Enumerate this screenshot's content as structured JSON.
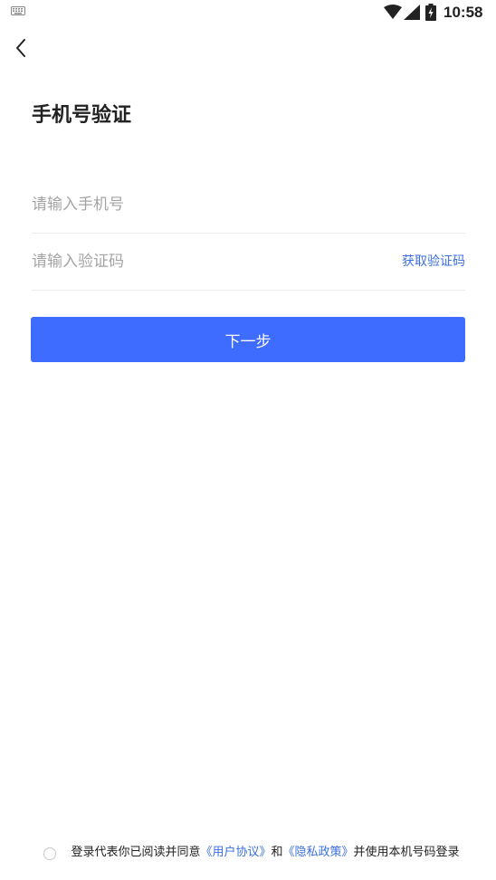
{
  "status_bar": {
    "time": "10:58",
    "icons": [
      "keyboard-icon",
      "wifi-icon",
      "cell-signal-icon",
      "battery-charging-icon"
    ]
  },
  "header": {
    "back_icon": "chevron-left-icon",
    "title": "手机号验证"
  },
  "form": {
    "phone_placeholder": "请输入手机号",
    "phone_value": "",
    "code_placeholder": "请输入验证码",
    "code_value": "",
    "get_code_label": "获取验证码"
  },
  "next_button_label": "下一步",
  "agreement": {
    "prefix": "登录代表你已阅读并同意",
    "user_agreement": "《用户协议》",
    "conjunction": "和",
    "privacy_policy": "《隐私政策》",
    "suffix": "并使用本机号码登录",
    "checked": false
  },
  "colors": {
    "accent": "#3d6cff",
    "link": "#3b6fe0",
    "placeholder": "#a4a4a4",
    "divider": "#ececec"
  }
}
